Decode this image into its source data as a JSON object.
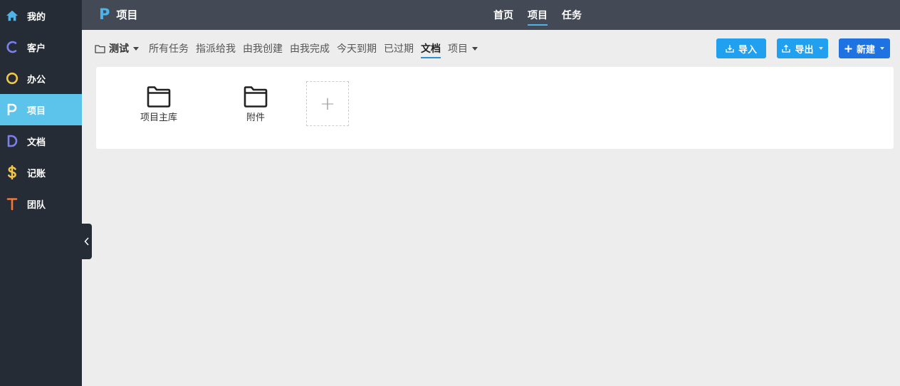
{
  "sidebar": {
    "items": [
      {
        "label": "我的",
        "icon": "home-icon",
        "color": "#4fb3e8"
      },
      {
        "label": "客户",
        "icon": "letter-c-icon",
        "color": "#7b7ff0"
      },
      {
        "label": "办公",
        "icon": "letter-o-icon",
        "color": "#f2c744"
      },
      {
        "label": "项目",
        "icon": "letter-p-icon",
        "color": "#ffffff"
      },
      {
        "label": "文档",
        "icon": "letter-d-icon",
        "color": "#7b7ff0"
      },
      {
        "label": "记账",
        "icon": "dollar-icon",
        "color": "#f2c744"
      },
      {
        "label": "团队",
        "icon": "letter-t-icon",
        "color": "#f07a3a"
      }
    ],
    "active_index": 3
  },
  "header": {
    "logo": "P",
    "title": "项目",
    "tabs": [
      "首页",
      "项目",
      "任务"
    ],
    "active_tab": 1
  },
  "toolbar": {
    "project_selector": "测试",
    "links": [
      "所有任务",
      "指派给我",
      "由我创建",
      "由我完成",
      "今天到期",
      "已过期",
      "文档",
      "项目"
    ],
    "active_link": 6
  },
  "buttons": {
    "import_label": "导入",
    "export_label": "导出",
    "new_label": "新建"
  },
  "content": {
    "folders": [
      "项目主库",
      "附件"
    ],
    "add_symbol": "+"
  },
  "colors": {
    "sidebar_bg": "#262c36",
    "sidebar_active": "#5cc3eb",
    "header_bg": "#434a56",
    "accent": "#4fb3e8",
    "button_blue": "#20a0ee",
    "button_new": "#1f73e0"
  }
}
